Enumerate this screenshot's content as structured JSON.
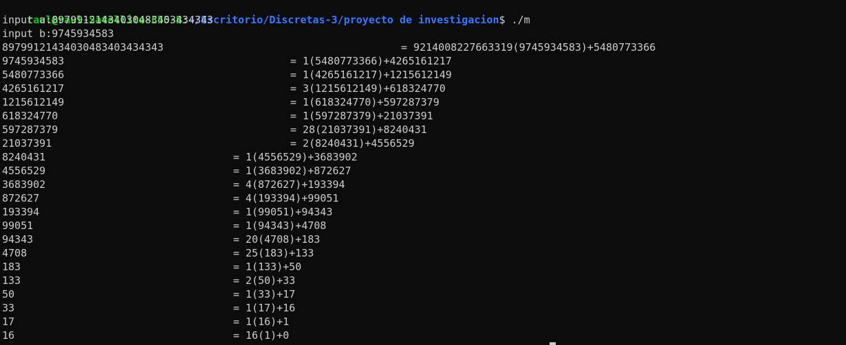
{
  "prompt": {
    "user_host": "raul@raul-Satellite-C55-B",
    "separator": ":",
    "path": "~/Escritorio/Discretas-3/proyecto de investigacion",
    "dollar": "$",
    "command": "./m"
  },
  "inputs": {
    "a": "input a:89799121434030483403434343",
    "b": "input b:9745934583"
  },
  "steps": [
    {
      "left": "89799121434030483403434343",
      "right": "= 9214008227663319(9745934583)+5480773366"
    },
    {
      "left": "9745934583",
      "right": "= 1(5480773366)+4265161217"
    },
    {
      "left": "5480773366",
      "right": "= 1(4265161217)+1215612149"
    },
    {
      "left": "4265161217",
      "right": "= 3(1215612149)+618324770"
    },
    {
      "left": "1215612149",
      "right": "= 1(618324770)+597287379"
    },
    {
      "left": "618324770",
      "right": "= 1(597287379)+21037391"
    },
    {
      "left": "597287379",
      "right": "= 28(21037391)+8240431"
    },
    {
      "left": "21037391",
      "right": "= 2(8240431)+4556529"
    },
    {
      "left": "8240431",
      "right": "= 1(4556529)+3683902"
    },
    {
      "left": "4556529",
      "right": "= 1(3683902)+872627"
    },
    {
      "left": "3683902",
      "right": "= 4(872627)+193394"
    },
    {
      "left": "872627",
      "right": "= 4(193394)+99051"
    },
    {
      "left": "193394",
      "right": "= 1(99051)+94343"
    },
    {
      "left": "99051",
      "right": "= 1(94343)+4708"
    },
    {
      "left": "94343",
      "right": "= 20(4708)+183"
    },
    {
      "left": "4708",
      "right": "= 25(183)+133"
    },
    {
      "left": "183",
      "right": "= 1(133)+50"
    },
    {
      "left": "133",
      "right": "= 2(50)+33"
    },
    {
      "left": "50",
      "right": "= 1(33)+17"
    },
    {
      "left": "33",
      "right": "= 1(17)+16"
    },
    {
      "left": "17",
      "right": "= 1(16)+1"
    },
    {
      "left": "16",
      "right": "= 16(1)+0"
    }
  ],
  "colors": {
    "background": "#0c0c0c",
    "text": "#cccccc",
    "user_host": "#16c60c",
    "path": "#3b78ff"
  }
}
